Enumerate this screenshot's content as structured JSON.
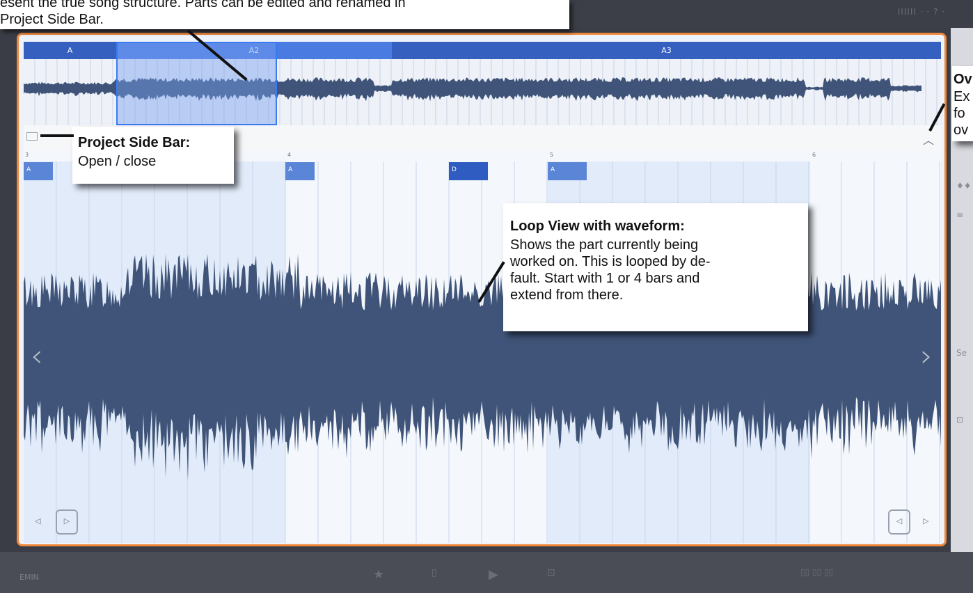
{
  "top_callout": {
    "text_line1": "esent the true song structure. Parts can be edited and renamed in",
    "text_line2": "Project Side Bar."
  },
  "topbar": {
    "right_text": "IIIIII   ·  ·   ?  ·"
  },
  "overview": {
    "parts": [
      {
        "label": "A",
        "color": "#3560c0"
      },
      {
        "label": "A2",
        "color": "#4a7be0"
      },
      {
        "label": "A3",
        "color": "#3560c0"
      }
    ]
  },
  "ruler": {
    "bars": [
      "3",
      "4",
      "5",
      "6"
    ]
  },
  "chords": [
    {
      "label": "A",
      "color": "#5b86d8"
    },
    {
      "label": "A",
      "color": "#5b86d8"
    },
    {
      "label": "D",
      "color": "#2f5cc0"
    },
    {
      "label": "A",
      "color": "#5b86d8"
    }
  ],
  "callouts": {
    "sidebar": {
      "heading": "Project Side Bar:",
      "text": "Open / close"
    },
    "loop": {
      "heading": "Loop View with waveform:",
      "text1": "Shows the part currently being",
      "text2": "worked on. This is looped by de-",
      "text3": "fault. Start with 1 or 4 bars and",
      "text4": "extend from there."
    },
    "overview": {
      "heading": "Ov",
      "text1": "Ex",
      "text2": "fo",
      "text3": "ov"
    }
  },
  "bottombar": {
    "key": "EMIN"
  },
  "icons": [
    "sidebar-toggle-icon",
    "chevron-up-icon",
    "chevron-left-icon",
    "chevron-right-icon",
    "play-icon",
    "star-icon"
  ],
  "colors": {
    "accent_border": "#f0883c",
    "waveform": "#3f5478",
    "part_blue": "#3560c0"
  }
}
